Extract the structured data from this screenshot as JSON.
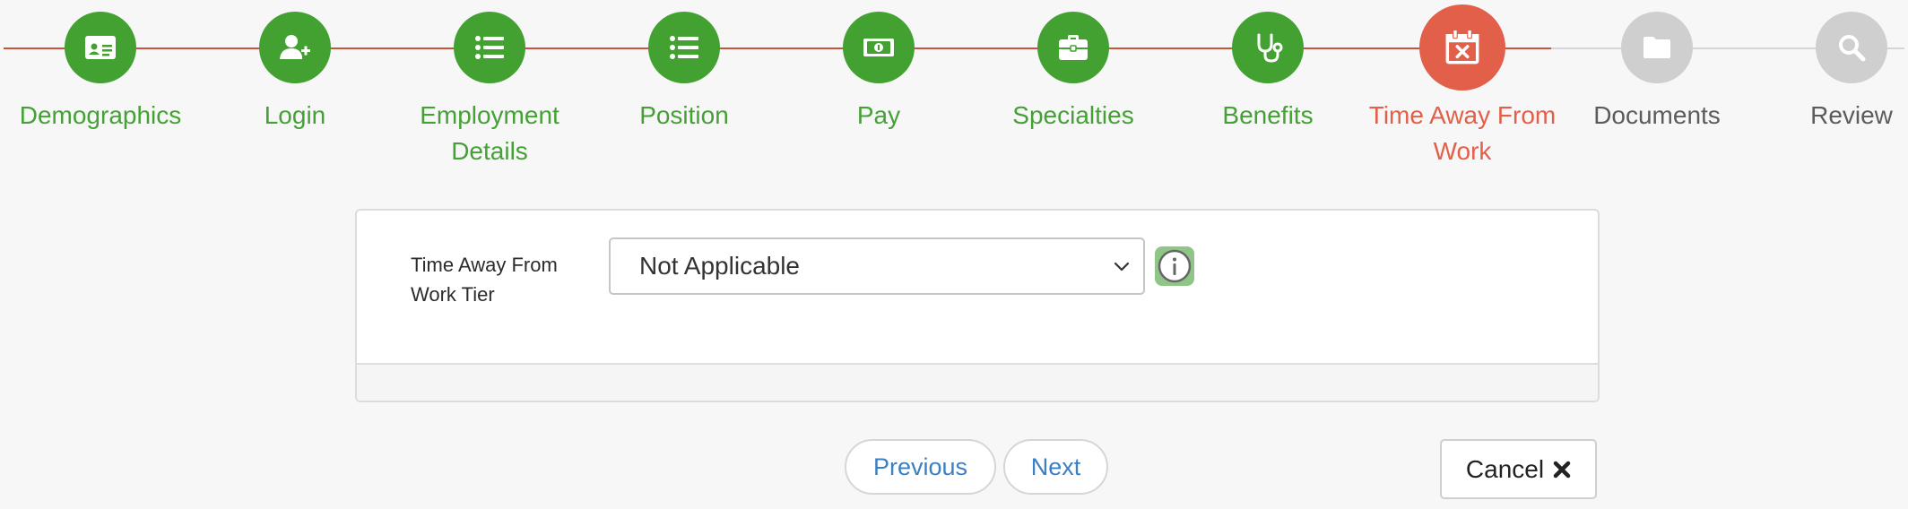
{
  "stepper": {
    "steps": [
      {
        "label": "Demographics",
        "icon": "id-card-icon",
        "state": "complete"
      },
      {
        "label": "Login",
        "icon": "user-plus-icon",
        "state": "complete"
      },
      {
        "label": "Employment Details",
        "icon": "list-icon",
        "state": "complete"
      },
      {
        "label": "Position",
        "icon": "list-icon",
        "state": "complete"
      },
      {
        "label": "Pay",
        "icon": "money-bill-icon",
        "state": "complete"
      },
      {
        "label": "Specialties",
        "icon": "briefcase-icon",
        "state": "complete"
      },
      {
        "label": "Benefits",
        "icon": "stethoscope-icon",
        "state": "complete"
      },
      {
        "label": "Time Away From Work",
        "icon": "calendar-x-icon",
        "state": "active"
      },
      {
        "label": "Documents",
        "icon": "folder-icon",
        "state": "todo"
      },
      {
        "label": "Review",
        "icon": "search-icon",
        "state": "todo"
      }
    ]
  },
  "form": {
    "tier_label": "Time Away From Work Tier",
    "tier_value": "Not Applicable",
    "info_icon": "info-circle-icon"
  },
  "actions": {
    "previous_label": "Previous",
    "next_label": "Next",
    "cancel_label": "Cancel",
    "cancel_icon": "close-icon"
  },
  "colors": {
    "complete": "#43a132",
    "active": "#e2604a",
    "todo": "#cfcfcf",
    "link": "#3b7fc4",
    "progress_line": "#c9533a"
  }
}
